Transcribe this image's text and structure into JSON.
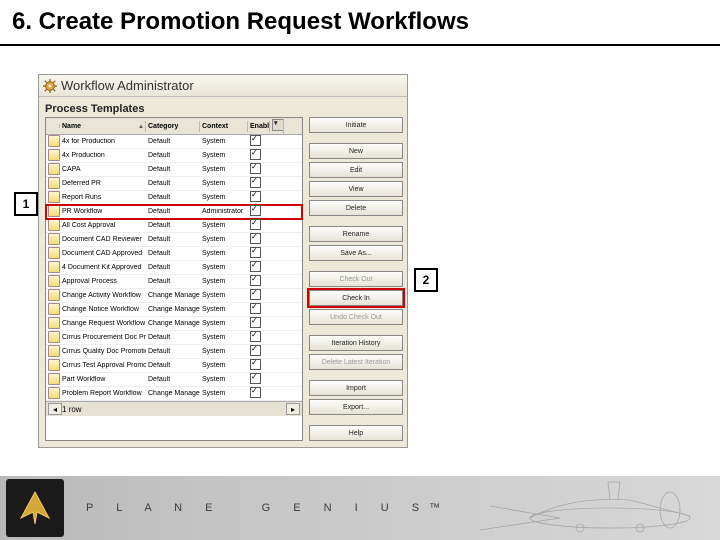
{
  "title": "6. Create Promotion Request Workflows",
  "window": {
    "header": "Workflow Administrator",
    "section": "Process Templates"
  },
  "grid": {
    "columns": [
      "",
      "Name",
      "Category",
      "Context",
      "Enabled",
      ""
    ],
    "rows": [
      {
        "name": "4x for Production",
        "category": "Default",
        "context": "System",
        "enabled": true
      },
      {
        "name": "4x Production",
        "category": "Default",
        "context": "System",
        "enabled": true
      },
      {
        "name": "CAPA",
        "category": "Default",
        "context": "System",
        "enabled": true
      },
      {
        "name": "Deferred PR",
        "category": "Default",
        "context": "System",
        "enabled": true
      },
      {
        "name": "Report Runs",
        "category": "Default",
        "context": "System",
        "enabled": true
      },
      {
        "name": "PR Workflow",
        "category": "Default",
        "context": "Administrator",
        "enabled": true
      },
      {
        "name": "All Cost Approval",
        "category": "Default",
        "context": "System",
        "enabled": true
      },
      {
        "name": "Document CAD Reviewer",
        "category": "Default",
        "context": "System",
        "enabled": true
      },
      {
        "name": "Document CAD Approved",
        "category": "Default",
        "context": "System",
        "enabled": true
      },
      {
        "name": "4 Document Kit Approved",
        "category": "Default",
        "context": "System",
        "enabled": true
      },
      {
        "name": "Approval Process",
        "category": "Default",
        "context": "System",
        "enabled": true
      },
      {
        "name": "Change Activity Workflow",
        "category": "Change Manager",
        "context": "System",
        "enabled": true
      },
      {
        "name": "Change Notice Workflow",
        "category": "Change Manager",
        "context": "System",
        "enabled": true
      },
      {
        "name": "Change Request Workflow",
        "category": "Change Manager",
        "context": "System",
        "enabled": true
      },
      {
        "name": "Cirrus Procurement Doc Promo",
        "category": "Default",
        "context": "System",
        "enabled": true
      },
      {
        "name": "Cirrus Quality Doc Promotion R",
        "category": "Default",
        "context": "System",
        "enabled": true
      },
      {
        "name": "Cirrus Test Approval Promotion",
        "category": "Default",
        "context": "System",
        "enabled": true
      },
      {
        "name": "Part Workflow",
        "category": "Default",
        "context": "System",
        "enabled": true
      },
      {
        "name": "Problem Report Workflow",
        "category": "Change Manager",
        "context": "System",
        "enabled": true
      }
    ],
    "highlight_row_index": 5,
    "scroll_left_label": "1 row"
  },
  "buttons": {
    "initiate": "Initiate",
    "new": "New",
    "edit": "Edit",
    "view": "View",
    "delete": "Delete",
    "rename": "Rename",
    "saveas": "Save As...",
    "checkout": "Check Out",
    "checkin": "Check In",
    "undocheckout": "Undo Check Out",
    "iterhist": "Iteration History",
    "dellatest": "Delete Latest Iteration",
    "import": "Import",
    "export": "Export...",
    "help": "Help",
    "highlight_key": "checkin"
  },
  "callouts": {
    "one": "1",
    "two": "2"
  },
  "footer": {
    "brand_left": "P L A N E",
    "brand_right": "G E N I U S",
    "tm": "™"
  }
}
